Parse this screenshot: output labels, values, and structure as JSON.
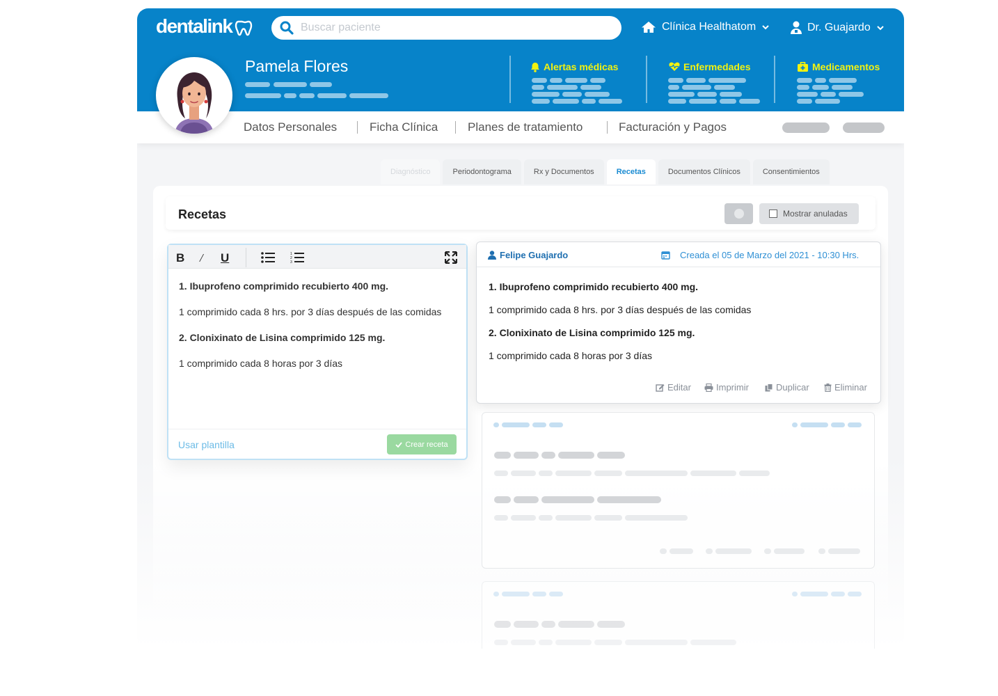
{
  "brand": {
    "logo_text": "dentalink",
    "primary_color": "#0783c9",
    "alert_color": "#f3f20f"
  },
  "search": {
    "placeholder": "Buscar paciente",
    "icon": "search-icon"
  },
  "header": {
    "clinic": "Clínica Healthatom",
    "user": "Dr. Guajardo"
  },
  "patient": {
    "name": "Pamela Flores"
  },
  "alerts": [
    {
      "label": "Alertas médicas",
      "icon": "bell-icon"
    },
    {
      "label": "Enfermedades",
      "icon": "heart-pulse-icon"
    },
    {
      "label": "Medicamentos",
      "icon": "medkit-icon"
    }
  ],
  "nav": [
    "Datos Personales",
    "Ficha Clínica",
    "Planes de tratamiento",
    "Facturación y Pagos"
  ],
  "tabs": [
    "Diagnóstico",
    "Periodontograma",
    "Rx y Documentos",
    "Recetas",
    "Documentos Clínicos",
    "Consentimientos"
  ],
  "active_tab": "Recetas",
  "section": {
    "title": "Recetas",
    "show_annulled": "Mostrar anuladas"
  },
  "editor": {
    "lines": [
      "1. Ibuprofeno comprimido recubierto 400 mg.",
      "1 comprimido cada 8 hrs. por 3 días después de las comidas",
      "2. Clonixinato de Lisina comprimido 125 mg.",
      "1 comprimido cada 8 horas por 3 días"
    ],
    "use_template": "Usar plantilla",
    "create_button": "Crear receta"
  },
  "prescription": {
    "doctor": "Felipe Guajardo",
    "created": "Creada el 05 de Marzo del 2021 - 10:30 Hrs.",
    "lines": [
      "1. Ibuprofeno comprimido recubierto 400 mg.",
      "1 comprimido cada 8 hrs. por 3 días después de las comidas",
      "2. Clonixinato de Lisina comprimido 125 mg.",
      "1 comprimido cada 8 horas por 3 días"
    ],
    "actions": {
      "edit": "Editar",
      "print": "Imprimir",
      "duplicate": "Duplicar",
      "delete": "Eliminar"
    }
  }
}
